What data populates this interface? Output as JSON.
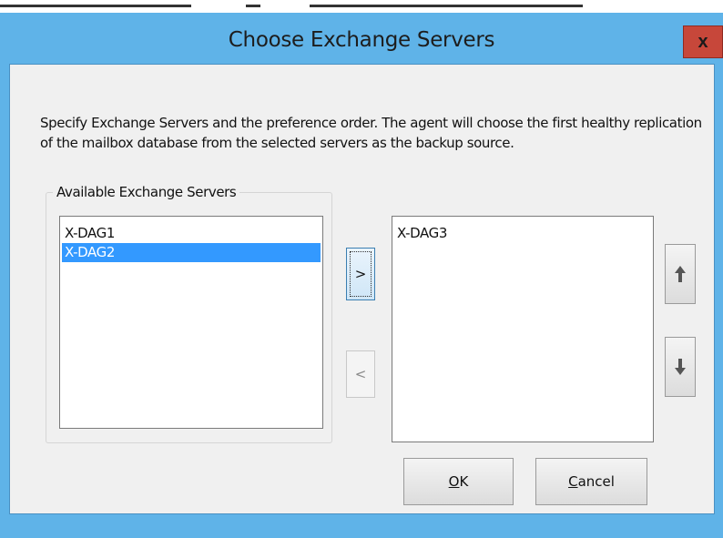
{
  "dialog": {
    "title": "Choose Exchange Servers",
    "close_label": "x"
  },
  "description": {
    "line1": "Specify Exchange Servers and the preference order. The agent will choose the first healthy replication",
    "line2": "of the mailbox database from the selected servers as the backup source."
  },
  "available_group": {
    "label": "Available Exchange Servers",
    "items": [
      {
        "label": "X-DAG1",
        "selected": false
      },
      {
        "label": "X-DAG2",
        "selected": true
      }
    ]
  },
  "selected_list": {
    "items": [
      {
        "label": "X-DAG3",
        "selected": false
      }
    ]
  },
  "buttons": {
    "move_right": ">",
    "move_left": "<",
    "move_up_icon": "arrow-up-icon",
    "move_down_icon": "arrow-down-icon",
    "ok_mnemonic": "O",
    "ok_rest": "K",
    "cancel_mnemonic": "C",
    "cancel_rest": "ancel"
  },
  "colors": {
    "window_frame": "#5fb3e8",
    "close_button": "#c7473a",
    "selection": "#3399ff"
  }
}
